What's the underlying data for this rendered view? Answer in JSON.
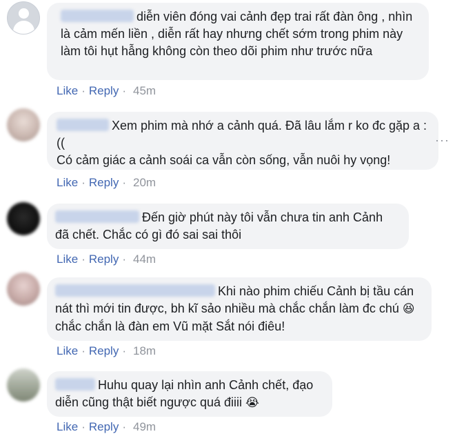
{
  "comments": [
    {
      "text": "diễn viên đóng vai cảnh đẹp trai rất đàn ông , nhìn là cảm mến liền , diễn rất hay nhưng chết sớm trong phim này làm tôi hụt hẫng không còn theo dõi phim như trước nữa",
      "like": "Like",
      "reply": "Reply",
      "time": "45m"
    },
    {
      "text": "Xem phim mà nhớ a cảnh quá. Đã lâu lắm r ko đc gặp a :((",
      "text2": "Có cảm giác a cảnh soái ca vẫn còn sống, vẫn nuôi hy vọng!",
      "like": "Like",
      "reply": "Reply",
      "time": "20m",
      "more": "···"
    },
    {
      "text": "Đến giờ phút này tôi vẫn chưa tin anh Cảnh đã chết. Chắc có gì đó sai sai thôi",
      "like": "Like",
      "reply": "Reply",
      "time": "44m"
    },
    {
      "text": "Khi nào phim chiếu Cảnh bị tầu cán nát thì mới tin được, bh kĩ sảo nhiều mà chắc chắn làm đc chú",
      "emoji": "😆",
      "text_after": "chắc chắn là đàn em Vũ mặt Sắt nói điêu!",
      "like": "Like",
      "reply": "Reply",
      "time": "18m"
    },
    {
      "text": "Huhu quay lại nhìn anh Cảnh chết, đạo diễn cũng thật biết ngược quá điiii",
      "emoji": "😭",
      "like": "Like",
      "reply": "Reply",
      "time": "49m"
    }
  ],
  "colors": {
    "link": "#4267b2",
    "bubble": "#f2f3f5",
    "meta": "#90949c",
    "text": "#1c1e21"
  },
  "icons": {
    "default_avatar": "default-avatar-icon",
    "more": "more-options-icon",
    "laugh": "laughing-emoji-icon",
    "cry": "crying-emoji-icon"
  }
}
